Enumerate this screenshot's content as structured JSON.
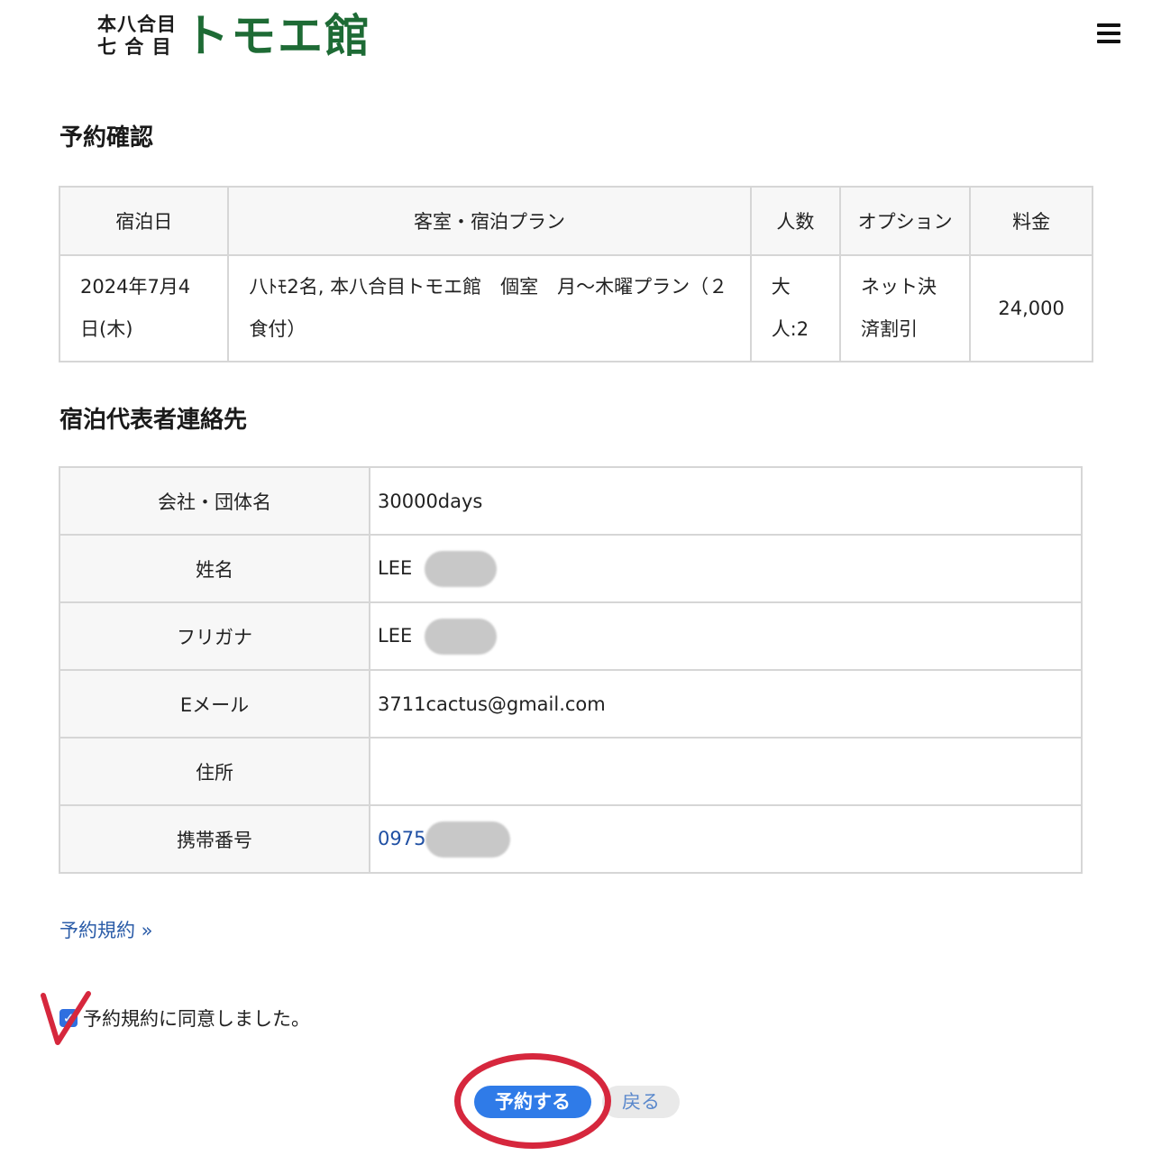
{
  "header": {
    "logo_small_line1": "本八合目",
    "logo_small_line2": "七 合 目",
    "logo_main": "トモエ館",
    "menu_icon": "hamburger-menu-icon"
  },
  "reservation": {
    "title": "予約確認",
    "columns": [
      "宿泊日",
      "客室・宿泊プラン",
      "人数",
      "オプション",
      "料金"
    ],
    "row": {
      "date": "2024年7月4日(木)",
      "plan": "八ﾄﾓ2名, 本八合目トモエ館　個室　月〜木曜プラン（２食付）",
      "guests": "大人:2",
      "option": "ネット決済割引",
      "price": "24,000"
    }
  },
  "contact": {
    "title": "宿泊代表者連絡先",
    "rows": [
      {
        "label": "会社・団体名",
        "value": "30000days"
      },
      {
        "label": "姓名",
        "value": "LEE"
      },
      {
        "label": "フリガナ",
        "value": "LEE"
      },
      {
        "label": "Eメール",
        "value": "3711cactus@gmail.com"
      },
      {
        "label": "住所",
        "value": ""
      },
      {
        "label": "携帯番号",
        "value": "0975"
      }
    ]
  },
  "terms": {
    "link_label": "予約規約 »",
    "agree_label": "予約規約に同意しました。",
    "agree_checked": true
  },
  "actions": {
    "reserve_label": "予約する",
    "back_label": "戻る"
  },
  "colors": {
    "accent": "#2f7be8",
    "brand": "#1e6b35",
    "annotation": "#d6273d"
  }
}
